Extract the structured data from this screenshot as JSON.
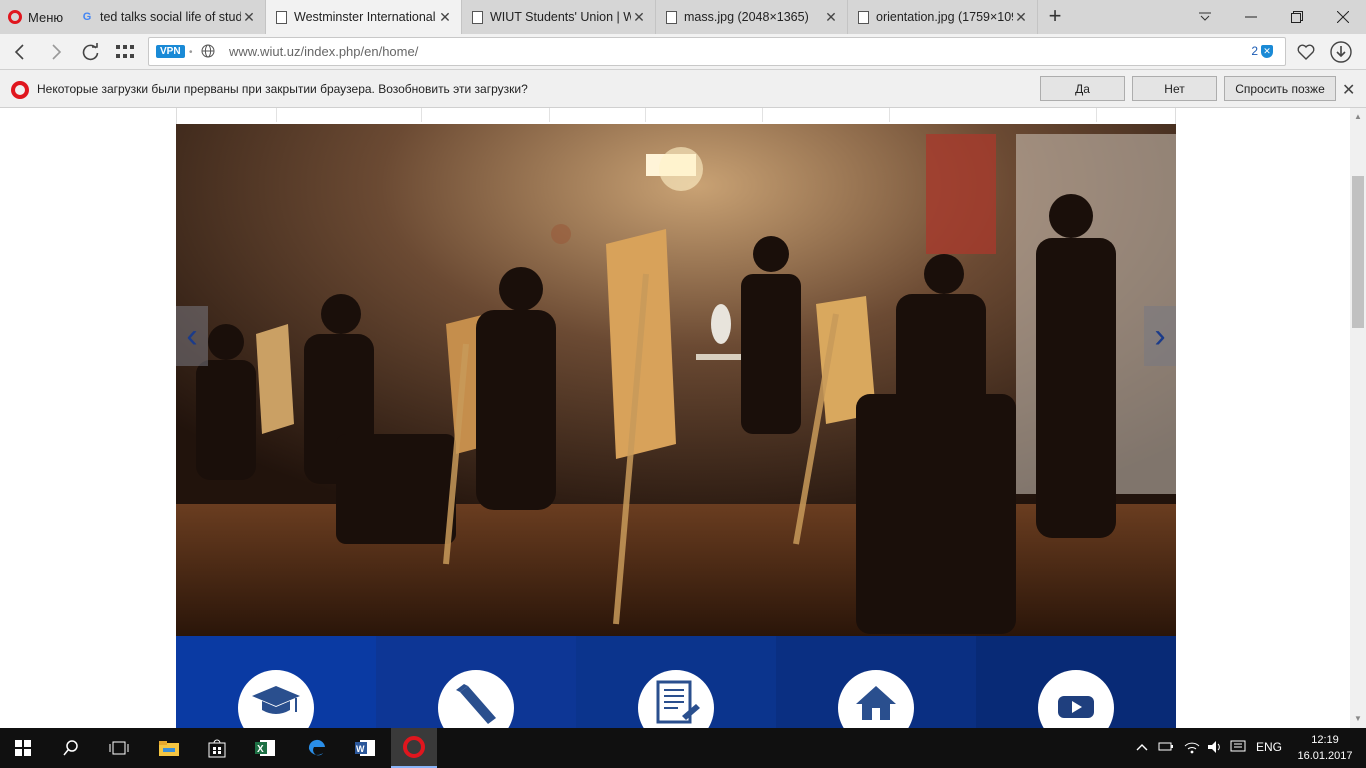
{
  "browser": {
    "menu_label": "Меню",
    "tabs": [
      {
        "title": "ted talks social life of stude",
        "icon": "google-icon"
      },
      {
        "title": "Westminster International",
        "icon": "page-icon",
        "active": true
      },
      {
        "title": "WIUT Students' Union | We",
        "icon": "page-icon"
      },
      {
        "title": "mass.jpg (2048×1365)",
        "icon": "page-icon"
      },
      {
        "title": "orientation.jpg (1759×109",
        "icon": "page-icon"
      }
    ],
    "vpn_label": "VPN",
    "url": "www.wiut.uz/index.php/en/home/",
    "blocked_count": "2"
  },
  "notification": {
    "text": "Некоторые загрузки были прерваны при закрытии браузера. Возобновить эти загрузки?",
    "yes_label": "Да",
    "no_label": "Нет",
    "later_label": "Спросить позже"
  },
  "page": {
    "slider": {
      "prev_label": "‹",
      "next_label": "›"
    },
    "quick_links": [
      {
        "icon": "graduation-cap-icon",
        "color": "#0a3aa3"
      },
      {
        "icon": "pencil-icon",
        "color": "#0d3695"
      },
      {
        "icon": "document-icon",
        "color": "#0b348d"
      },
      {
        "icon": "home-icon",
        "color": "#0a2f82"
      },
      {
        "icon": "youtube-icon",
        "color": "#082a76"
      }
    ]
  },
  "taskbar": {
    "language": "ENG",
    "time": "12:19",
    "date": "16.01.2017"
  }
}
